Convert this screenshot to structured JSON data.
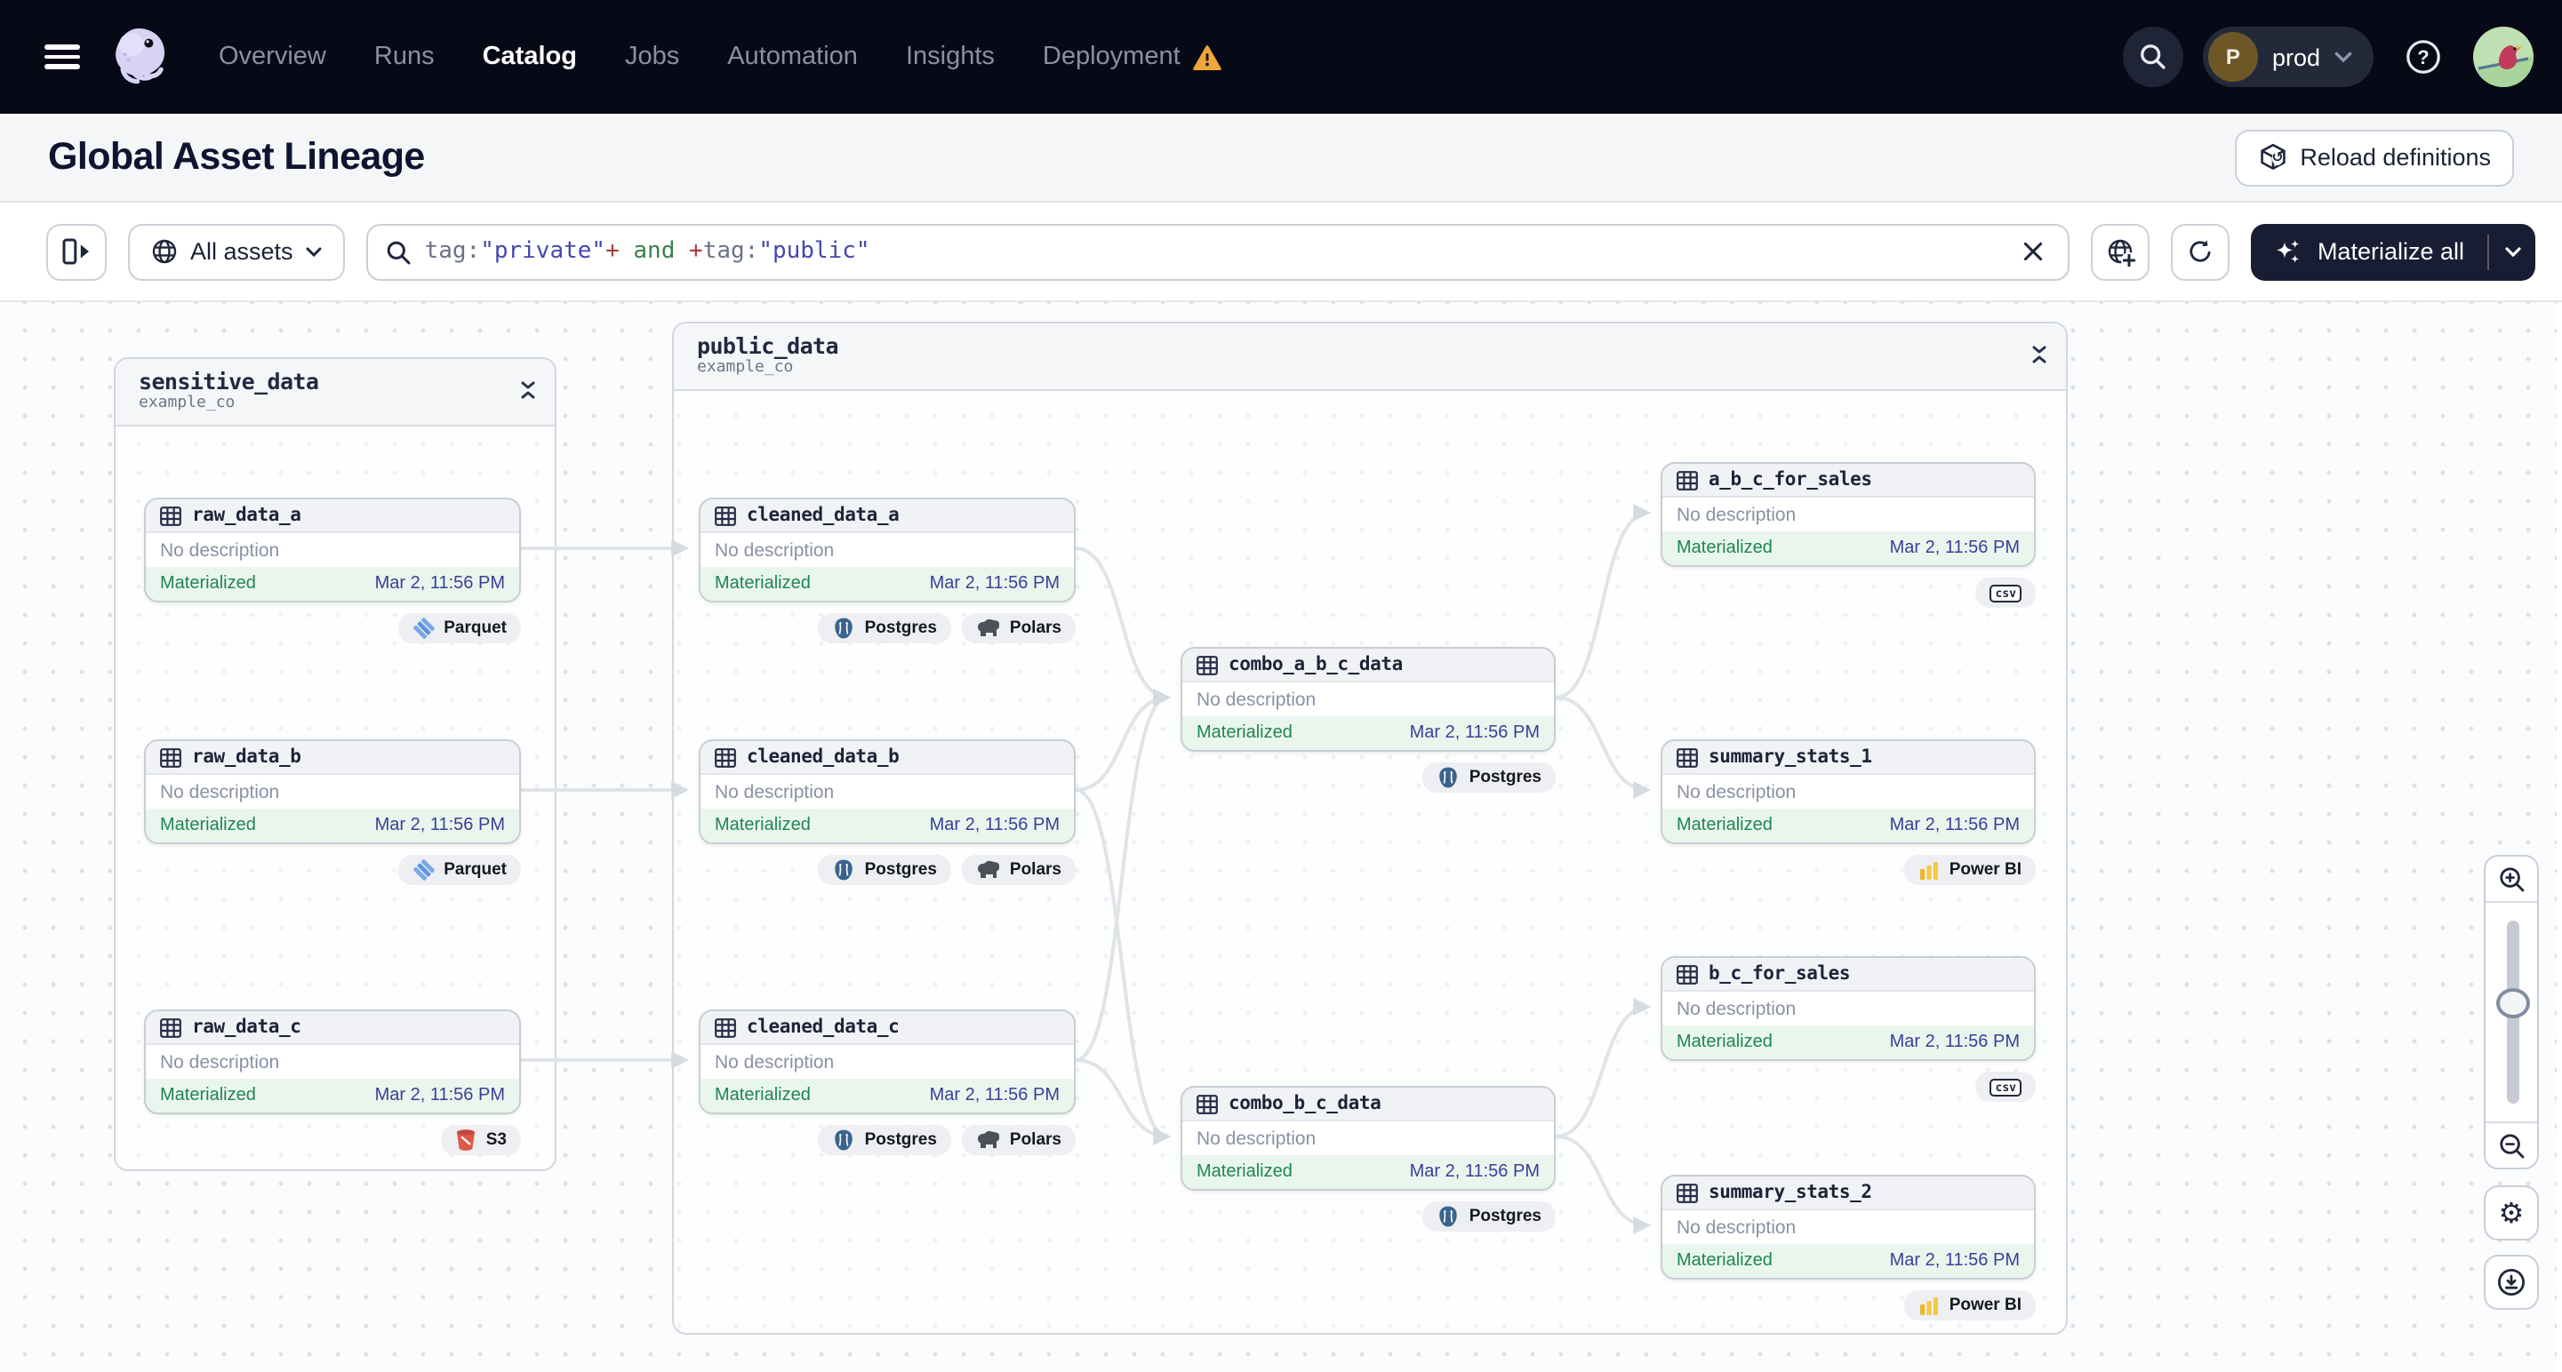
{
  "nav": {
    "items": [
      {
        "label": "Overview"
      },
      {
        "label": "Runs"
      },
      {
        "label": "Catalog"
      },
      {
        "label": "Jobs"
      },
      {
        "label": "Automation"
      },
      {
        "label": "Insights"
      },
      {
        "label": "Deployment"
      }
    ],
    "active_item": "Catalog",
    "workspace": {
      "initial": "P",
      "name": "prod"
    }
  },
  "header": {
    "title": "Global Asset Lineage",
    "reload_label": "Reload definitions"
  },
  "toolbar": {
    "scope_label": "All assets",
    "query": {
      "full": "tag:\"private\"+ and +tag:\"public\"",
      "tokens": [
        {
          "t": "tag:"
        },
        {
          "t": "\"private\""
        },
        {
          "t": "+"
        },
        {
          "t": " and "
        },
        {
          "t": "+"
        },
        {
          "t": "tag:"
        },
        {
          "t": "\"public\""
        }
      ]
    },
    "materialize_label": "Materialize all"
  },
  "graph": {
    "groups": [
      {
        "name": "sensitive_data",
        "subtitle": "example_co",
        "nodes": [
          {
            "name": "raw_data_a",
            "description": "No description",
            "status": "Materialized",
            "timestamp": "Mar 2, 11:56 PM",
            "badges": [
              {
                "label": "Parquet"
              }
            ]
          },
          {
            "name": "raw_data_b",
            "description": "No description",
            "status": "Materialized",
            "timestamp": "Mar 2, 11:56 PM",
            "badges": [
              {
                "label": "Parquet"
              }
            ]
          },
          {
            "name": "raw_data_c",
            "description": "No description",
            "status": "Materialized",
            "timestamp": "Mar 2, 11:56 PM",
            "badges": [
              {
                "label": "S3"
              }
            ]
          }
        ]
      },
      {
        "name": "public_data",
        "subtitle": "example_co",
        "nodes": [
          {
            "name": "cleaned_data_a",
            "description": "No description",
            "status": "Materialized",
            "timestamp": "Mar 2, 11:56 PM",
            "badges": [
              {
                "label": "Postgres"
              },
              {
                "label": "Polars"
              }
            ]
          },
          {
            "name": "cleaned_data_b",
            "description": "No description",
            "status": "Materialized",
            "timestamp": "Mar 2, 11:56 PM",
            "badges": [
              {
                "label": "Postgres"
              },
              {
                "label": "Polars"
              }
            ]
          },
          {
            "name": "cleaned_data_c",
            "description": "No description",
            "status": "Materialized",
            "timestamp": "Mar 2, 11:56 PM",
            "badges": [
              {
                "label": "Postgres"
              },
              {
                "label": "Polars"
              }
            ]
          },
          {
            "name": "combo_a_b_c_data",
            "description": "No description",
            "status": "Materialized",
            "timestamp": "Mar 2, 11:56 PM",
            "badges": [
              {
                "label": "Postgres"
              }
            ]
          },
          {
            "name": "combo_b_c_data",
            "description": "No description",
            "status": "Materialized",
            "timestamp": "Mar 2, 11:56 PM",
            "badges": [
              {
                "label": "Postgres"
              }
            ]
          },
          {
            "name": "a_b_c_for_sales",
            "description": "No description",
            "status": "Materialized",
            "timestamp": "Mar 2, 11:56 PM",
            "badges": [
              {
                "label": "csv"
              }
            ]
          },
          {
            "name": "summary_stats_1",
            "description": "No description",
            "status": "Materialized",
            "timestamp": "Mar 2, 11:56 PM",
            "badges": [
              {
                "label": "Power BI"
              }
            ]
          },
          {
            "name": "b_c_for_sales",
            "description": "No description",
            "status": "Materialized",
            "timestamp": "Mar 2, 11:56 PM",
            "badges": [
              {
                "label": "csv"
              }
            ]
          },
          {
            "name": "summary_stats_2",
            "description": "No description",
            "status": "Materialized",
            "timestamp": "Mar 2, 11:56 PM",
            "badges": [
              {
                "label": "Power BI"
              }
            ]
          }
        ]
      }
    ]
  },
  "colors": {
    "nav_bg": "#070A16",
    "dark_button_bg": "#181D33",
    "status_green": "#208552",
    "status_green_bg": "#E9F6EE",
    "timestamp_indigo": "#3B3E97",
    "edge_gray": "#E0E3E8",
    "warning_orange": "#F0A63B",
    "query_value_indigo": "#4448AE",
    "query_operator_red": "#A33D35",
    "query_and_green": "#3C7F4B"
  }
}
